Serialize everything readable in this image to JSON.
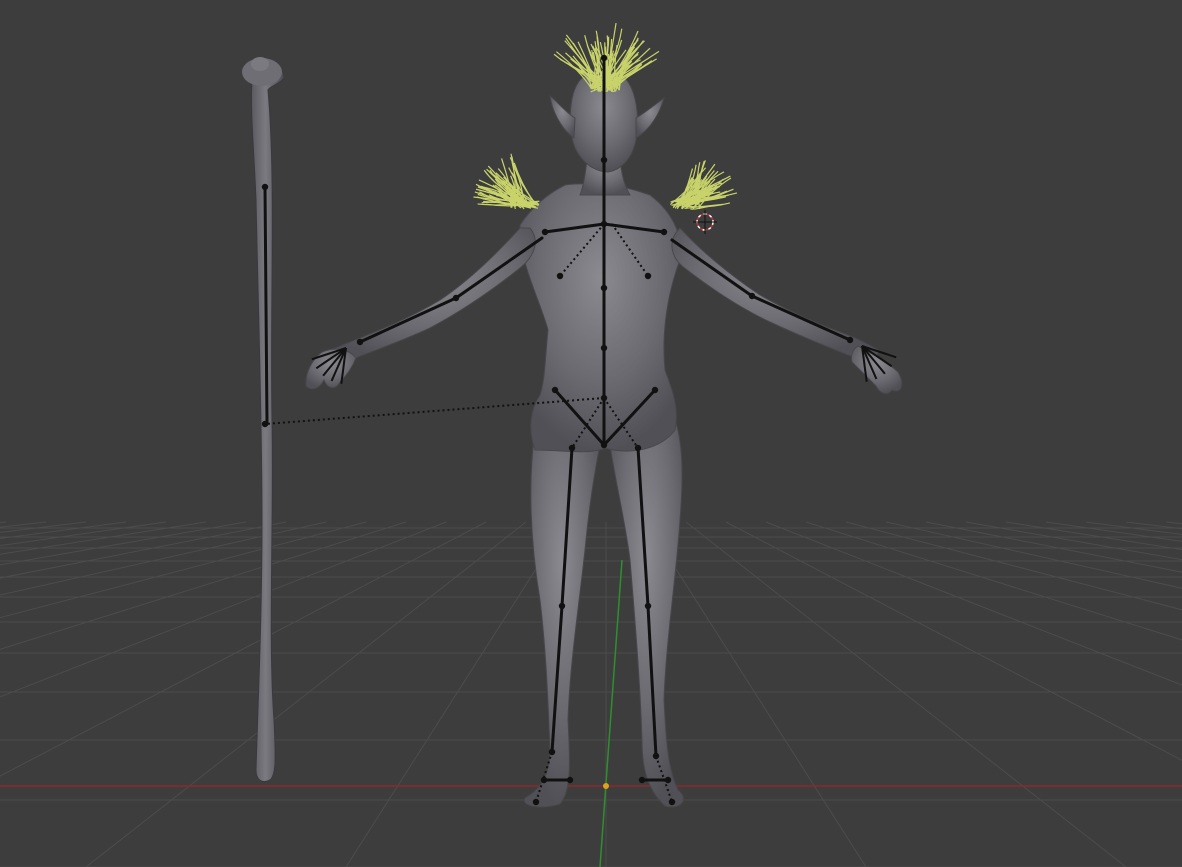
{
  "viewport": {
    "background": "#3d3d3d",
    "grid_color": "#4c4c4c",
    "x_axis_color": "#8b2a2a",
    "y_axis_color": "#2f8f2f",
    "origin_color": "#e0a020"
  },
  "scene": {
    "objects": [
      {
        "name": "staff",
        "type": "mesh",
        "color": "#6a6a6e"
      },
      {
        "name": "elf-character",
        "type": "mesh",
        "color": "#6b6b70"
      },
      {
        "name": "hair",
        "type": "particle-hair",
        "color": "#c9d36b"
      },
      {
        "name": "armature",
        "type": "armature",
        "color": "#111111"
      },
      {
        "name": "3d-cursor",
        "type": "cursor",
        "color": "#c33333"
      }
    ]
  }
}
